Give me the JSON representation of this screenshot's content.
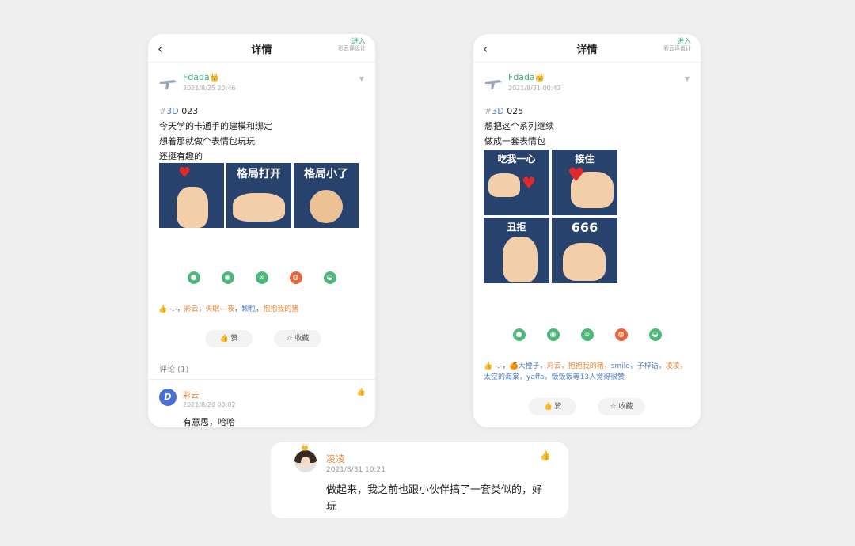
{
  "post1": {
    "nav": {
      "back": "‹",
      "title": "详情",
      "enter": "进入",
      "enter_sub": "彩云译设计"
    },
    "author": {
      "name": "Fdada",
      "time": "2021/8/25 20:46"
    },
    "tag": "3D",
    "tag_hash": "#",
    "post_no": "023",
    "lines": [
      "今天学的卡通手的建模和绑定",
      "想着那就做个表情包玩玩",
      "还挺有趣的"
    ],
    "tiles": [
      "",
      "格局打开",
      "格局小了"
    ],
    "likes": {
      "prefix": "-.-，",
      "names": [
        "彩云",
        "失眠---夜",
        "颗粒",
        "抱抱我的猪"
      ]
    },
    "like_btn": "赞",
    "fav_btn": "收藏",
    "comments_header": "评论 (1)",
    "comment": {
      "avatar": "D",
      "name": "彩云",
      "time": "2021/8/26 00:02",
      "text": "有意思，哈哈"
    }
  },
  "post2": {
    "nav": {
      "back": "‹",
      "title": "详情",
      "enter": "进入",
      "enter_sub": "彩云译设计"
    },
    "author": {
      "name": "Fdada",
      "time": "2021/8/31 00:43"
    },
    "tag": "3D",
    "tag_hash": "#",
    "post_no": "025",
    "lines": [
      "想把这个系列继续",
      "做成一套表情包"
    ],
    "tiles": [
      "吃我一心",
      "接住",
      "丑拒",
      "666"
    ],
    "likes_text_1": "-.-，",
    "likes_text_2": "大橙子，",
    "likes_text_3": "彩云，",
    "likes_text_4": "抱抱我的猪，",
    "likes_text_5": "smile，",
    "likes_text_6": "子梓语，",
    "likes_text_7": "凌凌，",
    "likes_text_8": "太空的海棠，",
    "likes_text_9": "yaffa，",
    "likes_text_10": "饭饭饭等13人觉得很赞",
    "like_btn": "赞",
    "fav_btn": "收藏"
  },
  "featured_comment": {
    "name": "凌凌",
    "time": "2021/8/31 10:21",
    "text": "做起来，我之前也跟小伙伴搞了一套类似的，好玩"
  },
  "icons": {
    "crown": "👑",
    "thumb": "👍",
    "share": [
      "wechat-icon",
      "moments-icon",
      "link-icon",
      "weibo-icon",
      "qq-icon"
    ]
  },
  "colors": {
    "accent_green": "#3db07a",
    "name_orange": "#e8883b",
    "tile_navy": "#28426e",
    "link_blue": "#4e7fc2"
  }
}
